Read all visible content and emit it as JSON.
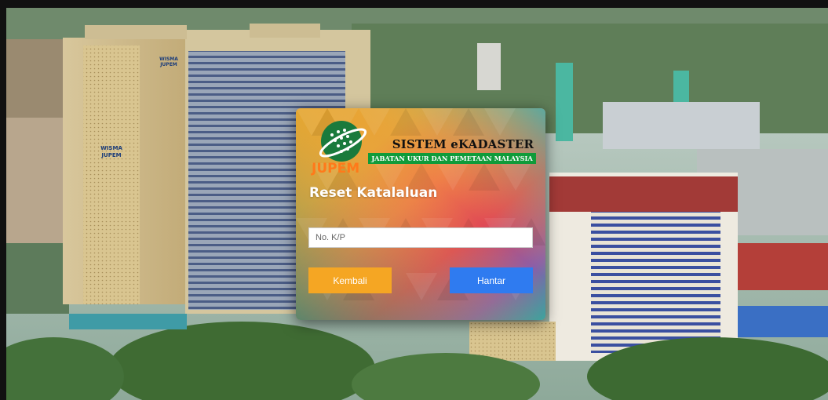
{
  "header": {
    "system_title": "SISTEM eKADASTER",
    "department": "JABATAN UKUR DAN PEMETAAN MALAYSIA",
    "logo_text": "JUPEM"
  },
  "building_signs": {
    "left_top": "WISMA JUPEM",
    "left_side": "WISMA JUPEM"
  },
  "form": {
    "heading": "Reset Katalaluan",
    "ic_placeholder": "No. K/P",
    "ic_value": "",
    "back_label": "Kembali",
    "submit_label": "Hantar"
  },
  "colors": {
    "back_button": "#f5a623",
    "submit_button": "#2f7bf0",
    "header_band": "#0f9b3a",
    "logo_accent": "#ff7a1a"
  }
}
